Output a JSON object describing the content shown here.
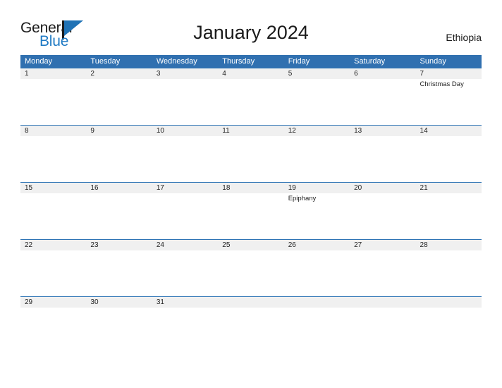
{
  "logo": {
    "text_general": "General",
    "text_blue": "Blue",
    "flag_icon": "flag-triangle-icon",
    "accent_color": "#1f72b5"
  },
  "header": {
    "title": "January 2024",
    "region": "Ethiopia"
  },
  "theme": {
    "header_blue": "#3070b0",
    "band_gray": "#f0f0f0",
    "rule_blue": "#2e74b5",
    "page_background": "#ffffff",
    "text_color": "#222222"
  },
  "calendar": {
    "month": "January",
    "year": "2024",
    "weekday_headers": [
      "Monday",
      "Tuesday",
      "Wednesday",
      "Thursday",
      "Friday",
      "Saturday",
      "Sunday"
    ],
    "weeks": [
      {
        "days": [
          {
            "date": "1",
            "event": ""
          },
          {
            "date": "2",
            "event": ""
          },
          {
            "date": "3",
            "event": ""
          },
          {
            "date": "4",
            "event": ""
          },
          {
            "date": "5",
            "event": ""
          },
          {
            "date": "6",
            "event": ""
          },
          {
            "date": "7",
            "event": "Christmas Day"
          }
        ]
      },
      {
        "days": [
          {
            "date": "8",
            "event": ""
          },
          {
            "date": "9",
            "event": ""
          },
          {
            "date": "10",
            "event": ""
          },
          {
            "date": "11",
            "event": ""
          },
          {
            "date": "12",
            "event": ""
          },
          {
            "date": "13",
            "event": ""
          },
          {
            "date": "14",
            "event": ""
          }
        ]
      },
      {
        "days": [
          {
            "date": "15",
            "event": ""
          },
          {
            "date": "16",
            "event": ""
          },
          {
            "date": "17",
            "event": ""
          },
          {
            "date": "18",
            "event": ""
          },
          {
            "date": "19",
            "event": "Epiphany"
          },
          {
            "date": "20",
            "event": ""
          },
          {
            "date": "21",
            "event": ""
          }
        ]
      },
      {
        "days": [
          {
            "date": "22",
            "event": ""
          },
          {
            "date": "23",
            "event": ""
          },
          {
            "date": "24",
            "event": ""
          },
          {
            "date": "25",
            "event": ""
          },
          {
            "date": "26",
            "event": ""
          },
          {
            "date": "27",
            "event": ""
          },
          {
            "date": "28",
            "event": ""
          }
        ]
      },
      {
        "days": [
          {
            "date": "29",
            "event": ""
          },
          {
            "date": "30",
            "event": ""
          },
          {
            "date": "31",
            "event": ""
          },
          {
            "date": "",
            "event": ""
          },
          {
            "date": "",
            "event": ""
          },
          {
            "date": "",
            "event": ""
          },
          {
            "date": "",
            "event": ""
          }
        ]
      }
    ]
  }
}
